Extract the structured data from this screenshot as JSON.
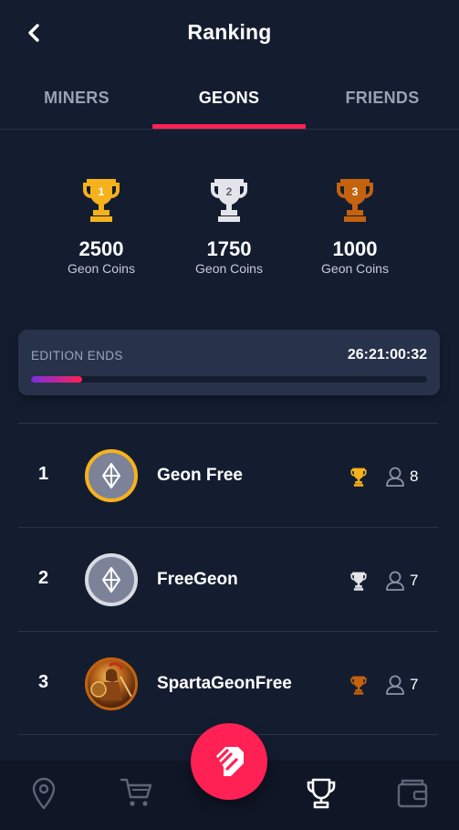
{
  "header": {
    "title": "Ranking",
    "back_icon": "chevron-left-icon"
  },
  "tabs": [
    {
      "label": "MINERS",
      "active": false
    },
    {
      "label": "GEONS",
      "active": true
    },
    {
      "label": "FRIENDS",
      "active": false
    }
  ],
  "prizes": [
    {
      "place": "1",
      "amount": "2500",
      "unit": "Geon Coins",
      "color": "#f6b21c"
    },
    {
      "place": "2",
      "amount": "1750",
      "unit": "Geon Coins",
      "color": "#e3e5ea"
    },
    {
      "place": "3",
      "amount": "1000",
      "unit": "Geon Coins",
      "color": "#c4620e"
    }
  ],
  "edition": {
    "label": "EDITION ENDS",
    "time": "26:21:00:32",
    "progress": 0.13
  },
  "ranking": [
    {
      "rank": "1",
      "name": "Geon Free",
      "count": "8",
      "trophy_color": "#f6b21c",
      "avatar_ring": "#f6b21c"
    },
    {
      "rank": "2",
      "name": "FreeGeon",
      "count": "7",
      "trophy_color": "#e3e5ea",
      "avatar_ring": "#d8dbe2"
    },
    {
      "rank": "3",
      "name": "SpartaGeonFree",
      "count": "7",
      "trophy_color": "#c4620e",
      "avatar_ring": "#c4620e"
    }
  ],
  "nav": {
    "items": [
      "location-pin-icon",
      "cart-icon",
      "trophy-icon",
      "wallet-icon"
    ],
    "active": "trophy-icon",
    "fab_icon": "geon-logo-icon"
  },
  "colors": {
    "background": "#141d30",
    "accent": "#ff2154",
    "card": "#28324a"
  }
}
